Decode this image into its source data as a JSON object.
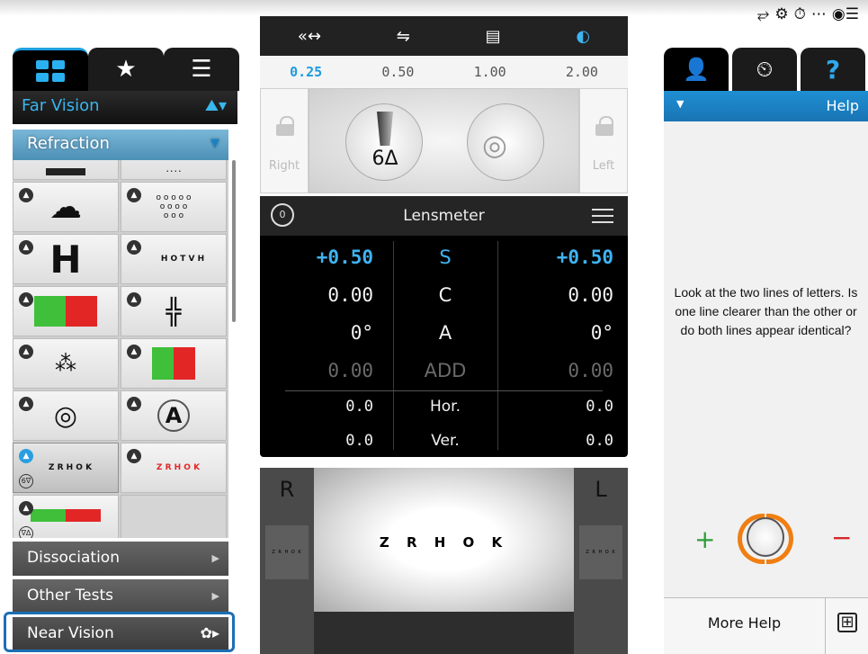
{
  "status_bar": {
    "icons": [
      "connection-icon",
      "settings-gear-icon",
      "timer-icon",
      "dots-icon",
      "toggle-menu-icon"
    ]
  },
  "left_panel": {
    "tabs": [
      {
        "name": "charts-grid",
        "icon": "grid-icon"
      },
      {
        "name": "favorites",
        "icon": "star-icon"
      },
      {
        "name": "list",
        "icon": "list-icon"
      }
    ],
    "category": "Far Vision",
    "section": "Refraction",
    "nav": [
      {
        "label": "Dissociation"
      },
      {
        "label": "Other Tests"
      },
      {
        "label": "Near Vision"
      }
    ],
    "tests": [
      {
        "label": "",
        "icon": "bar-chart-icon"
      },
      {
        "label": "",
        "icon": "letter-chart-icon"
      },
      {
        "label": "",
        "icon": "tree-symbol-icon"
      },
      {
        "label": "",
        "icon": "circles-chart-icon"
      },
      {
        "label": "H",
        "icon": "letter-h-icon"
      },
      {
        "label": "H O T V H",
        "icon": "hotv-chart-icon"
      },
      {
        "label": "",
        "icon": "red-green-letters-icon"
      },
      {
        "label": "",
        "icon": "cross-cylinder-icon"
      },
      {
        "label": "",
        "icon": "dot-cluster-icon"
      },
      {
        "label": "",
        "icon": "red-green-rings-icon"
      },
      {
        "label": "",
        "icon": "target-icon"
      },
      {
        "label": "A",
        "icon": "letter-a-icon"
      },
      {
        "label": "Z R H O K",
        "icon": "zrhok-chart-icon",
        "badge": "6∇"
      },
      {
        "label": "Z R H O K",
        "icon": "red-green-zrhok-icon"
      },
      {
        "label": "",
        "icon": "red-green-bar-icon",
        "badge": "∇Δ"
      },
      {
        "label": "",
        "icon": ""
      }
    ]
  },
  "prism": {
    "steps": [
      "0.25",
      "0.50",
      "1.00",
      "2.00"
    ],
    "active_step": "0.25",
    "right_label": "Right",
    "left_label": "Left",
    "prism_value": "6Δ"
  },
  "lensmeter": {
    "title": "Lensmeter",
    "rows": [
      {
        "right": "+0.50",
        "label": "S",
        "left": "+0.50"
      },
      {
        "right": "0.00",
        "label": "C",
        "left": "0.00"
      },
      {
        "right": "0°",
        "label": "A",
        "left": "0°"
      },
      {
        "right": "0.00",
        "label": "ADD",
        "left": "0.00"
      },
      {
        "right": "0.0",
        "label": "Hor.",
        "left": "0.0"
      },
      {
        "right": "0.0",
        "label": "Ver.",
        "left": "0.0"
      }
    ]
  },
  "display": {
    "right_eye": "R",
    "left_eye": "L",
    "chart_text": "Z R H O K",
    "mini_text": "Z R H O K"
  },
  "right_panel": {
    "help_title": "Help",
    "help_text": "Look at the two lines of letters. Is one line clearer than the other or do both lines appear identical?",
    "plus": "+",
    "minus": "−",
    "more_help": "More Help",
    "expand": "⊞"
  },
  "colors": {
    "accent": "#1e9be0",
    "plus": "#2e9e3a",
    "minus": "#d42a2a",
    "dial": "#f07e12",
    "highlight": "#1d6fb5"
  }
}
